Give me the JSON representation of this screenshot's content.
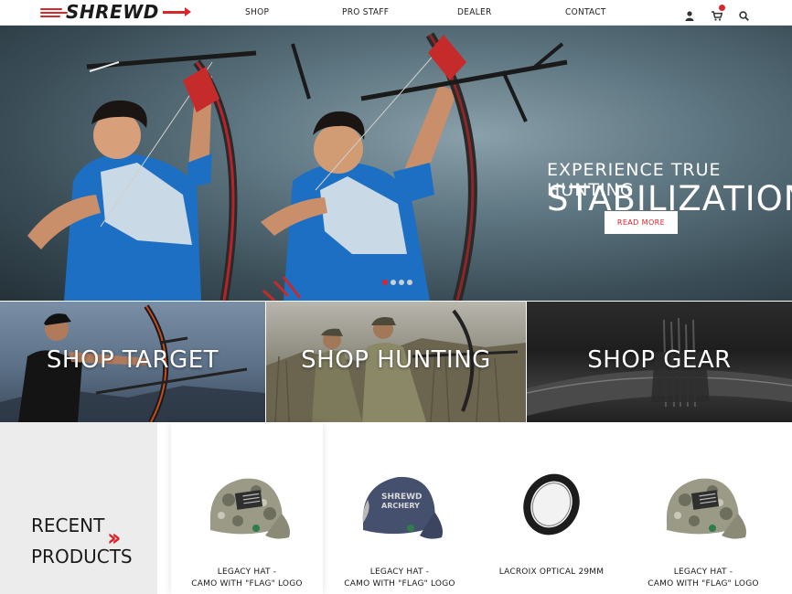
{
  "header": {
    "logo_text": "SHREWD",
    "nav": [
      "SHOP",
      "PRO STAFF",
      "DEALER",
      "CONTACT"
    ],
    "icons": [
      "user-icon",
      "cart-icon",
      "search-icon"
    ]
  },
  "hero": {
    "title_line1": "EXPERIENCE TRUE HUNTING",
    "title_line2": "STABILIZATION",
    "cta_label": "READ MORE",
    "slides": 4,
    "active_slide": 1
  },
  "tiles": [
    {
      "label": "SHOP TARGET"
    },
    {
      "label": "SHOP HUNTING"
    },
    {
      "label": "SHOP GEAR"
    }
  ],
  "recent": {
    "title": "RECENT PRODUCTS",
    "products": [
      {
        "name_line1": "LEGACY HAT -",
        "name_line2": "CAMO WITH \"FLAG\" LOGO"
      },
      {
        "name_line1": "LEGACY HAT -",
        "name_line2": "CAMO WITH \"FLAG\" LOGO"
      },
      {
        "name_line1": "LACROIX OPTICAL 29MM",
        "name_line2": ""
      },
      {
        "name_line1": "LEGACY HAT -",
        "name_line2": "CAMO WITH \"FLAG\" LOGO"
      }
    ]
  },
  "colors": {
    "accent": "#d8262b",
    "text": "#1a1a1a",
    "panel": "#ececec"
  }
}
